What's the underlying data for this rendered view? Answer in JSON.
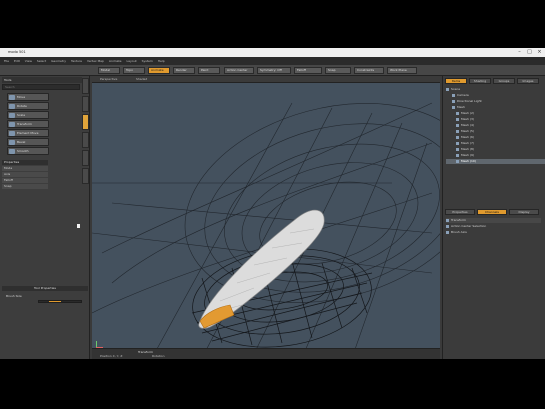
{
  "window": {
    "title": "modo 501",
    "controls": [
      "–",
      "□",
      "×"
    ]
  },
  "menu": [
    "File",
    "Edit",
    "View",
    "Select",
    "Geometry",
    "Texture",
    "Vertex Map",
    "Animate",
    "Layout",
    "System",
    "Help"
  ],
  "toolbar": {
    "tabs": [
      "Model",
      "Topo",
      "Animate",
      "Render",
      "Paint"
    ],
    "active_tab": "Animate",
    "right_items": [
      "Action Center",
      "Symmetry: Off",
      "Falloff",
      "Snap",
      "Constraints",
      "Work Plane"
    ]
  },
  "left_panel": {
    "title": "Tools",
    "search_placeholder": "Search",
    "tool_buttons": [
      "Move",
      "Rotate",
      "Scale",
      "Transform",
      "Element Move",
      "Bevel",
      "Smooth"
    ],
    "section_header": "Properties",
    "properties": [
      "Mode",
      "Axis",
      "Falloff",
      "Snap"
    ],
    "lower_header": "Tool Properties",
    "lower_label": "Brush Size"
  },
  "viewport": {
    "tabs": [
      "Perspective",
      "Shaded"
    ],
    "status_lines": [
      "Transform",
      "Position X, Y, Z",
      "Rotation"
    ]
  },
  "right_panel": {
    "tabs": [
      "Items",
      "Shading",
      "Groups",
      "Images"
    ],
    "active_tab": "Items",
    "tree": [
      {
        "label": "Scene",
        "selected": false
      },
      {
        "label": "Camera",
        "selected": false
      },
      {
        "label": "Directional Light",
        "selected": false
      },
      {
        "label": "Mesh",
        "selected": false
      },
      {
        "label": "Mesh (2)",
        "selected": false
      },
      {
        "label": "Mesh (3)",
        "selected": false
      },
      {
        "label": "Mesh (4)",
        "selected": false
      },
      {
        "label": "Mesh (5)",
        "selected": false
      },
      {
        "label": "Mesh (6)",
        "selected": false
      },
      {
        "label": "Mesh (7)",
        "selected": false
      },
      {
        "label": "Mesh (8)",
        "selected": false
      },
      {
        "label": "Mesh (9)",
        "selected": false
      },
      {
        "label": "Mesh (10)",
        "selected": true
      }
    ],
    "lower_tabs": [
      "Properties",
      "Channels",
      "Display"
    ],
    "lower_active": "Channels",
    "lower_rows": [
      "Transform",
      "Action Center Selection",
      "Brush Axis"
    ]
  },
  "colors": {
    "accent": "#e09a2e",
    "viewport_bg": "#44515e",
    "panel_bg": "#3b3b3b"
  },
  "icons": {
    "minimize": "minimize-icon",
    "maximize": "maximize-icon",
    "close": "close-icon",
    "tool": "tool-icon",
    "eye": "visibility-eye-icon",
    "cursor": "mouse-cursor-icon"
  }
}
